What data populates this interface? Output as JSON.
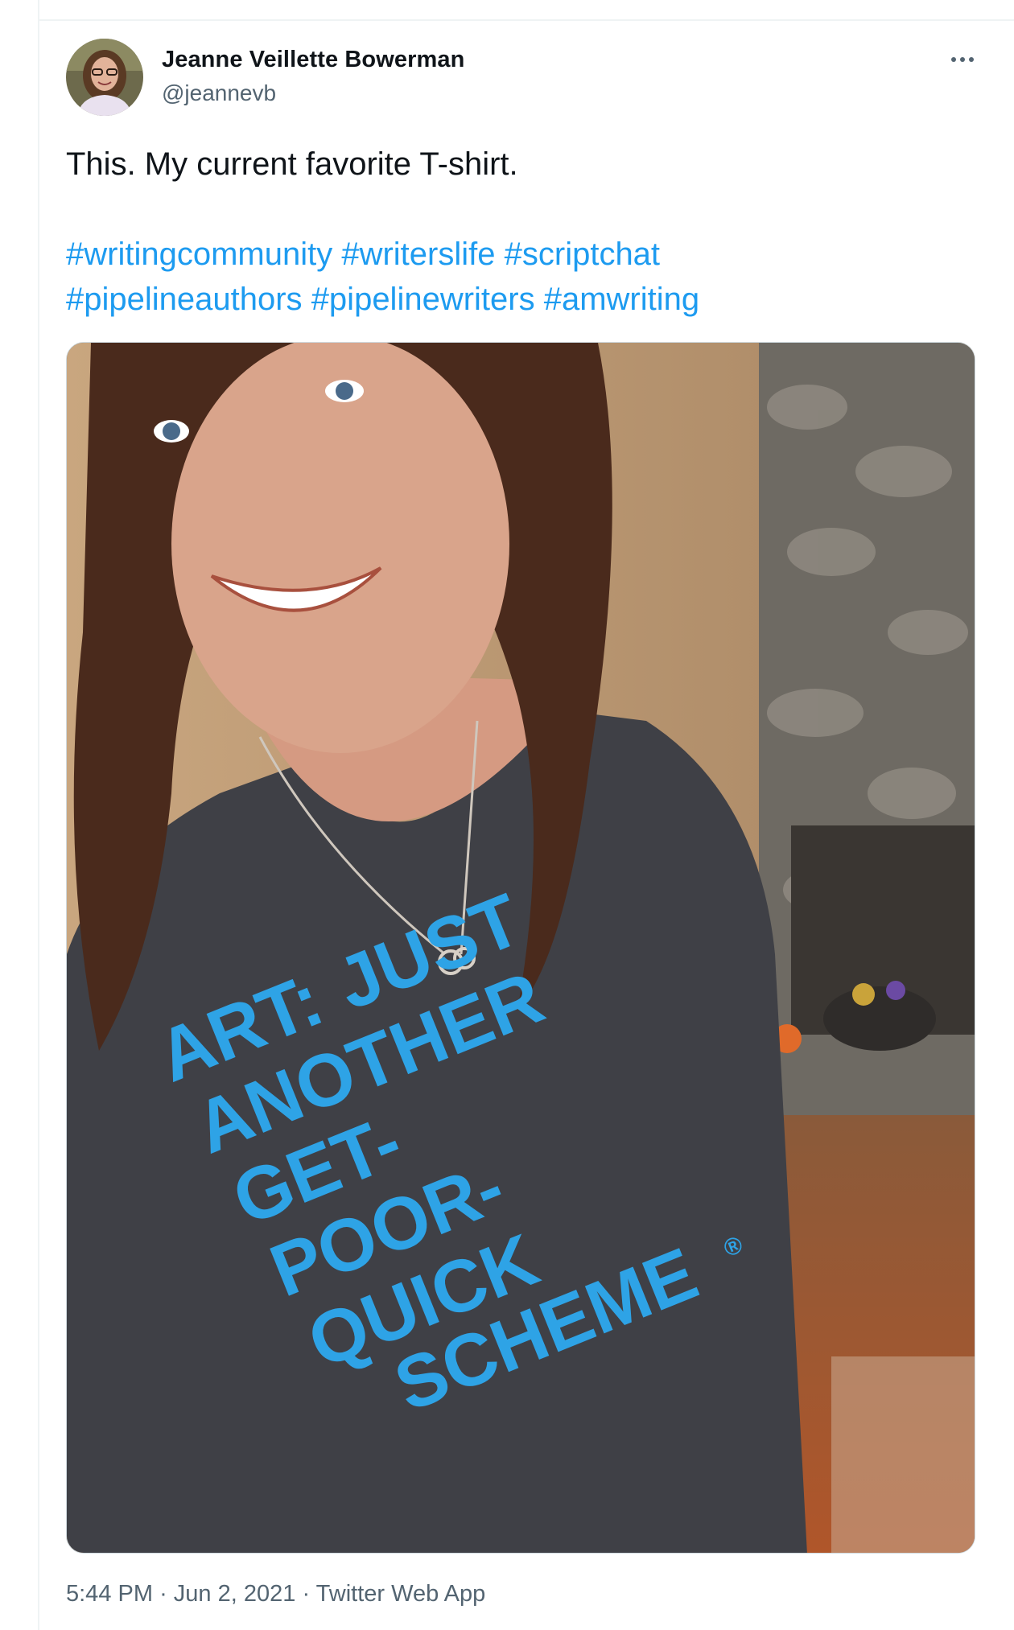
{
  "tweet": {
    "author": {
      "display_name": "Jeanne Veillette Bowerman",
      "handle": "@jeannevb"
    },
    "text": "This. My current favorite T-shirt.",
    "hashtag_rows": [
      [
        "#writingcommunity",
        "#writerslife",
        "#scriptchat"
      ],
      [
        "#pipelineauthors",
        "#pipelinewriters",
        "#amwriting"
      ]
    ],
    "shirt_text": [
      "ART:",
      "JUST",
      "ANOTHER",
      "GET-",
      "POOR-",
      "QUICK",
      "SCHEME",
      "®"
    ],
    "time": "5:44 PM",
    "date": "Jun 2, 2021",
    "source": "Twitter Web App",
    "separator": "·"
  },
  "colors": {
    "link": "#1d9bf0",
    "text": "#0f1419",
    "secondary": "#536471",
    "border": "#eff3f4",
    "shirt_print": "#2ea3e6",
    "shirt": "#3f4046"
  },
  "icons": {
    "more": "more-horizontal-icon"
  }
}
